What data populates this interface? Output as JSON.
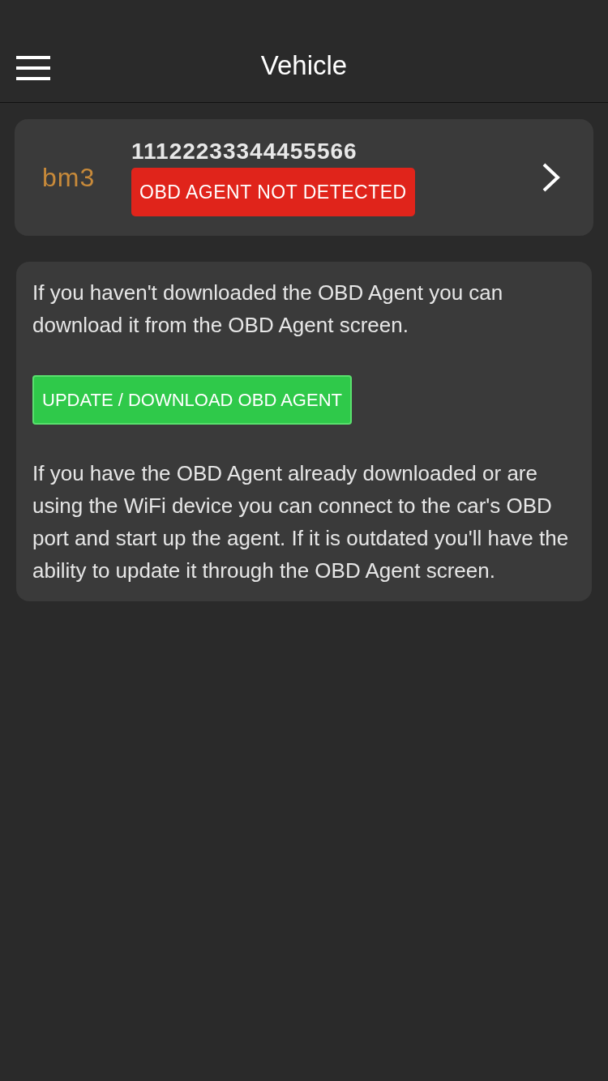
{
  "header": {
    "title": "Vehicle"
  },
  "vehicle_card": {
    "logo": "bm3",
    "vin": "11122233344455566",
    "status": "OBD AGENT NOT DETECTED",
    "detected": false
  },
  "info_card": {
    "paragraphs": [
      "If you haven't downloaded the OBD Agent you can download it from the OBD Agent screen.",
      "If you have the OBD Agent already downloaded or are using the WiFi device you can connect to the car's OBD port and start up the agent. If it is outdated you'll have the ability to update it through the OBD Agent screen."
    ],
    "button": "UPDATE / DOWNLOAD OBD AGENT"
  }
}
